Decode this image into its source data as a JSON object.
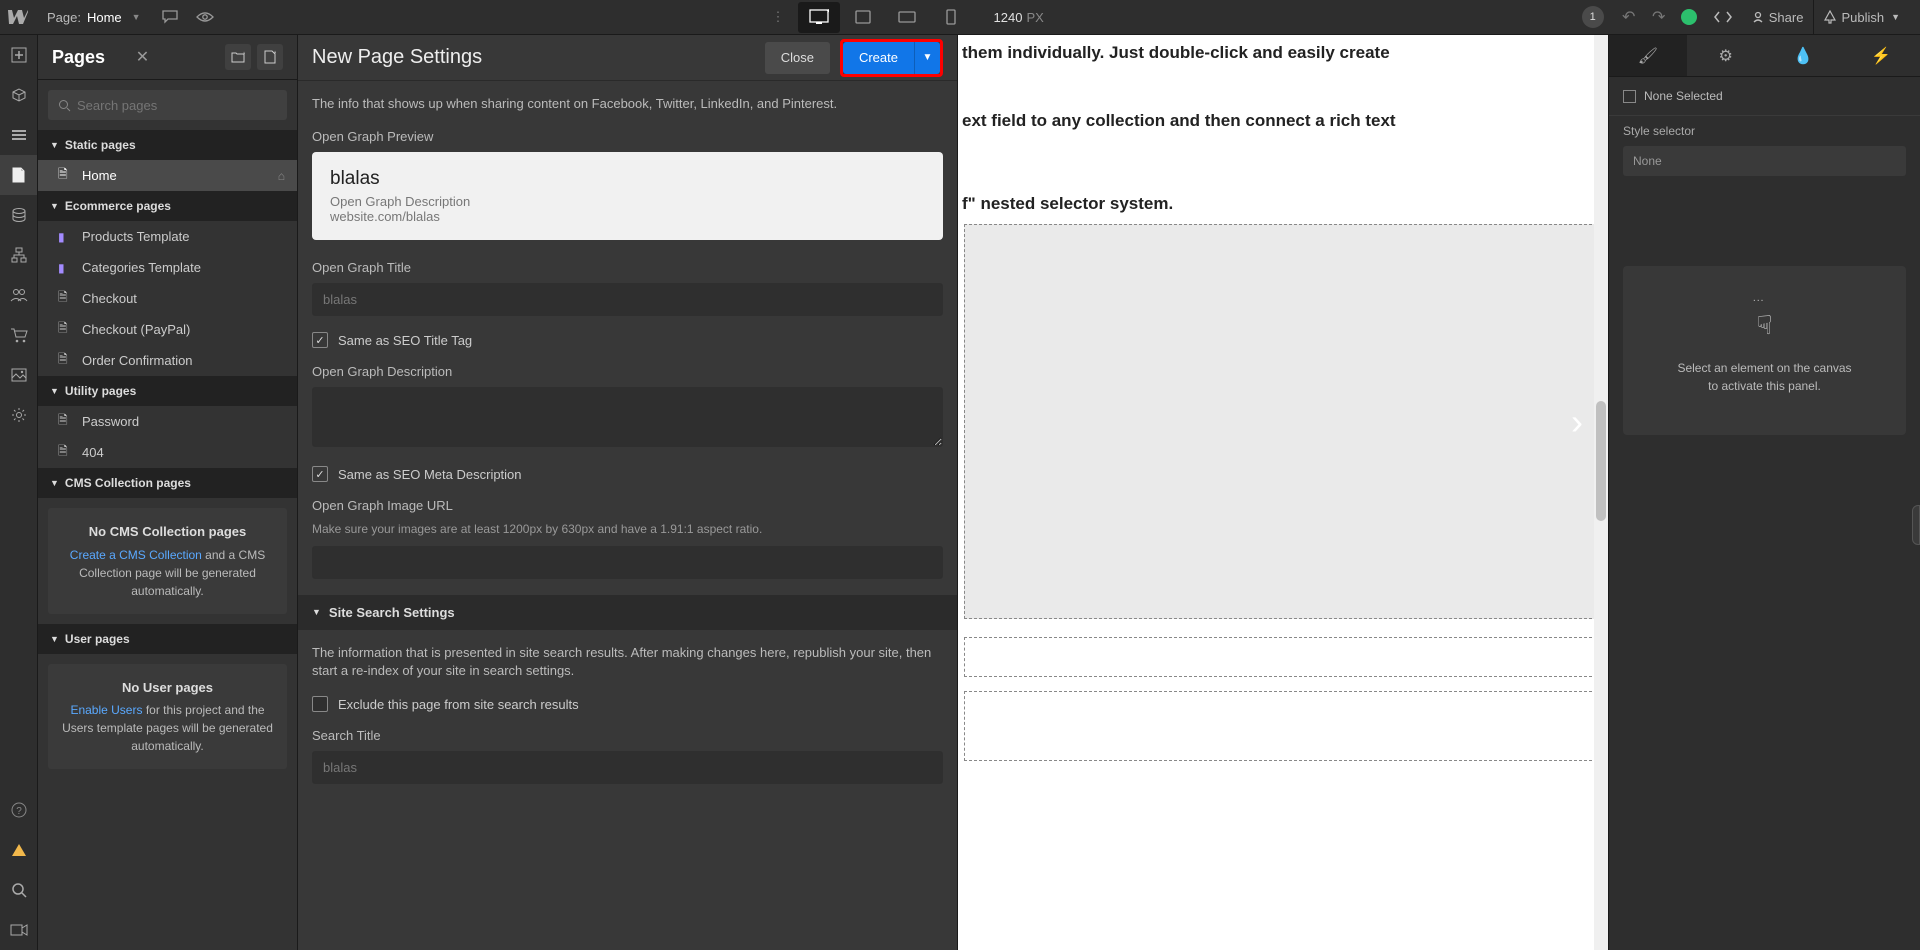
{
  "topbar": {
    "page_label": "Page:",
    "page_name": "Home",
    "canvas_width": "1240",
    "px_suffix": "PX",
    "changes_badge": "1",
    "share_label": "Share",
    "publish_label": "Publish"
  },
  "pages_panel": {
    "title": "Pages",
    "search_placeholder": "Search pages",
    "sections": {
      "static": "Static pages",
      "ecommerce": "Ecommerce pages",
      "utility": "Utility pages",
      "cms": "CMS Collection pages",
      "user": "User pages"
    },
    "items": {
      "home": "Home",
      "products_tpl": "Products Template",
      "categories_tpl": "Categories Template",
      "checkout": "Checkout",
      "checkout_paypal": "Checkout (PayPal)",
      "order_confirmation": "Order Confirmation",
      "password": "Password",
      "notfound": "404"
    },
    "cms_box": {
      "title": "No CMS Collection pages",
      "link": "Create a CMS Collection",
      "rest": " and a CMS Collection page will be generated automatically."
    },
    "user_box": {
      "title": "No User pages",
      "link": "Enable Users",
      "rest": " for this project and the Users template pages will be generated automatically."
    }
  },
  "settings": {
    "title": "New Page Settings",
    "close": "Close",
    "create": "Create",
    "intro": "The info that shows up when sharing content on Facebook, Twitter, LinkedIn, and Pinterest.",
    "og_preview_label": "Open Graph Preview",
    "og_preview": {
      "title": "blalas",
      "desc": "Open Graph Description",
      "url": "website.com/blalas"
    },
    "og_title_label": "Open Graph Title",
    "og_title_value": "blalas",
    "same_as_seo_title": "Same as SEO Title Tag",
    "og_desc_label": "Open Graph Description",
    "same_as_seo_meta": "Same as SEO Meta Description",
    "og_image_label": "Open Graph Image URL",
    "og_image_hint": "Make sure your images are at least 1200px by 630px and have a 1.91:1 aspect ratio.",
    "site_search_section": "Site Search Settings",
    "site_search_intro": "The information that is presented in site search results. After making changes here, republish your site, then start a re-index of your site in search settings.",
    "exclude_label": "Exclude this page from site search results",
    "search_title_label": "Search Title",
    "search_title_value": "blalas"
  },
  "canvas": {
    "line1": "them individually. Just double-click and easily create",
    "line2": "ext field to any collection and then connect a rich text",
    "line3": "f\" nested selector system."
  },
  "right": {
    "none_selected": "None Selected",
    "style_selector": "Style selector",
    "selector_value": "None",
    "placeholder_line1": "Select an element on the canvas",
    "placeholder_line2": "to activate this panel."
  }
}
